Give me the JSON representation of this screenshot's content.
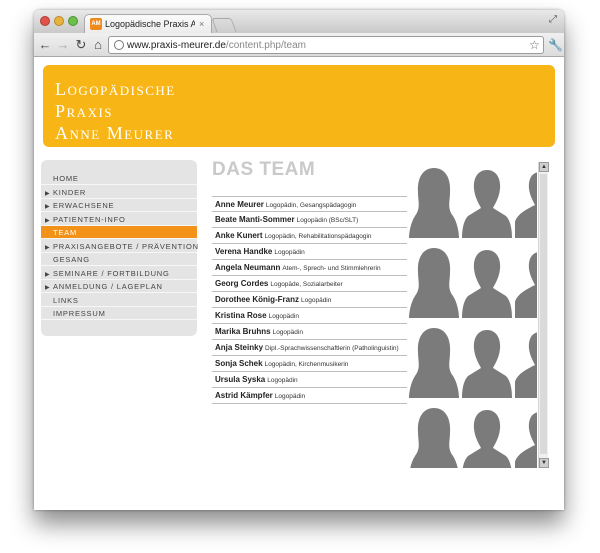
{
  "browser": {
    "tab_title": "Logopädische Praxis Anne M",
    "tab_close": "×",
    "favicon_label": "AM",
    "url_host": "www.praxis-meurer.de",
    "url_path": "/content.php/team"
  },
  "header": {
    "line1": "Logopädische",
    "line2": "Praxis",
    "line3": "Anne Meurer",
    "background_color": "#f7b516"
  },
  "menu": {
    "items": [
      {
        "label": "HOME",
        "arrow": false,
        "active": false
      },
      {
        "label": "KINDER",
        "arrow": true,
        "active": false
      },
      {
        "label": "ERWACHSENE",
        "arrow": true,
        "active": false
      },
      {
        "label": "PATIENTEN-INFO",
        "arrow": true,
        "active": false
      },
      {
        "label": "TEAM",
        "arrow": false,
        "active": true
      },
      {
        "label": "PRAXISANGEBOTE / PRÄVENTION",
        "arrow": true,
        "active": false
      },
      {
        "label": "GESANG",
        "arrow": false,
        "active": false
      },
      {
        "label": "SEMINARE / FORTBILDUNG",
        "arrow": true,
        "active": false
      },
      {
        "label": "ANMELDUNG / LAGEPLAN",
        "arrow": true,
        "active": false
      },
      {
        "label": "LINKS",
        "arrow": false,
        "active": false
      },
      {
        "label": "IMPRESSUM",
        "arrow": false,
        "active": false
      }
    ],
    "active_color": "#f39219"
  },
  "page": {
    "title": "DAS TEAM"
  },
  "team": [
    {
      "name": "Anne Meurer",
      "role": "Logopädin, Gesangspädagogin"
    },
    {
      "name": "Beate Manti-Sommer",
      "role": "Logopädin (BSc/SLT)"
    },
    {
      "name": "Anke Kunert",
      "role": "Logopädin, Rehabilitationspädagogin"
    },
    {
      "name": "Verena Handke",
      "role": "Logopädin"
    },
    {
      "name": "Angela Neumann",
      "role": "Atem-, Sprech- und Stimmlehrerin"
    },
    {
      "name": "Georg Cordes",
      "role": "Logopäde, Sozialarbeiter"
    },
    {
      "name": "Dorothee König-Franz",
      "role": "Logopädin"
    },
    {
      "name": "Kristina Rose",
      "role": "Logopädin"
    },
    {
      "name": "Marika Bruhns",
      "role": "Logopädin"
    },
    {
      "name": "Anja Steinky",
      "role": "Dipl.-Sprachwissenschaftlerin (Patholinguistin)"
    },
    {
      "name": "Sonja Schek",
      "role": "Logopädin, Kirchenmusikerin"
    },
    {
      "name": "Ursula Syska",
      "role": "Logopädin"
    },
    {
      "name": "Astrid Kämpfer",
      "role": "Logopädin"
    }
  ],
  "portrait_color": "#7b7b7b"
}
